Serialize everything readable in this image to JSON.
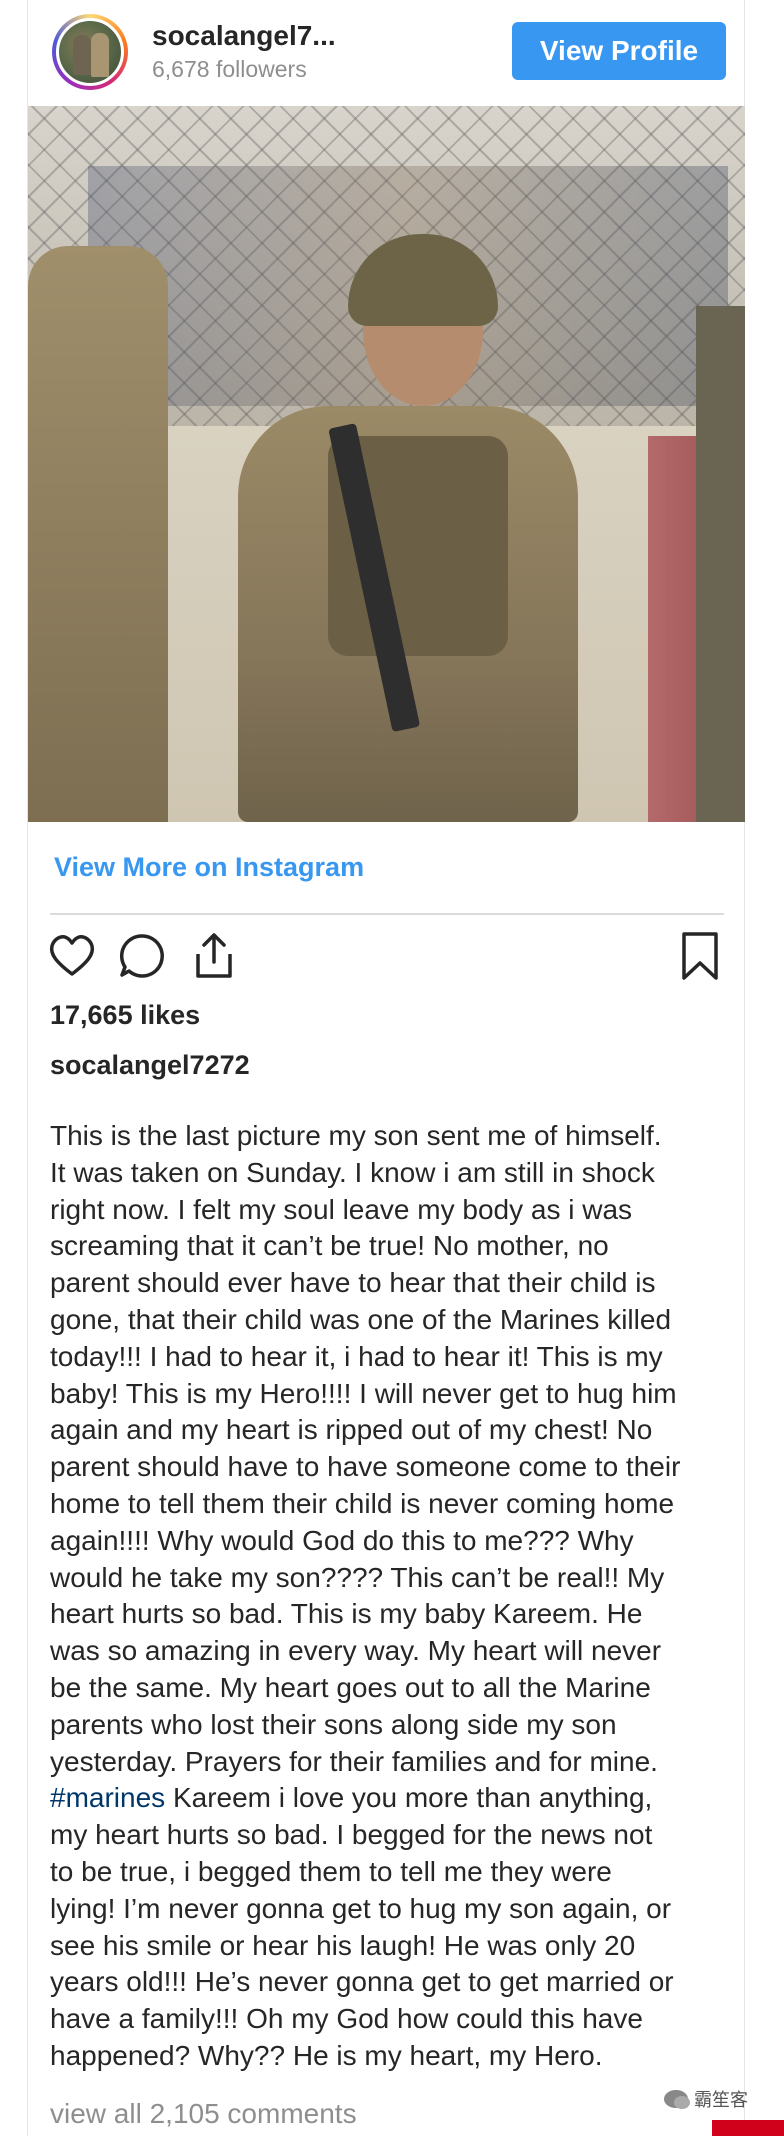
{
  "header": {
    "username": "socalangel7...",
    "followers": "6,678 followers",
    "view_profile_label": "View Profile"
  },
  "post": {
    "view_more_label": "View More on Instagram",
    "likes": "17,665 likes",
    "author": "socalangel7272",
    "caption_part1": "This is the last picture my son sent me of himself.\nIt was taken on Sunday. I know i am still in shock\nright now. I felt my soul leave my body as i was\nscreaming that it can’t be true! No mother, no\nparent should ever have to hear that their child is\ngone, that their child was one of the Marines killed\ntoday!!! I had to hear it, i had to hear it! This is my\nbaby! This is my Hero!!!! I will never get to hug him\nagain and my heart is ripped out of my chest! No\nparent should have to have someone come to their\nhome to tell them their child is never coming home\nagain!!!! Why would God do this to me??? Why\nwould he take my son???? This can’t be real!! My\nheart hurts so bad. This is my baby Kareem. He\nwas so amazing in every way. My heart will never\nbe the same. My heart goes out to all the Marine\nparents who lost their sons along side my son\nyesterday. Prayers for their families and for mine.\n",
    "hashtag": "#marines",
    "caption_part2": " Kareem i love you more than anything,\nmy heart hurts so bad. I begged for the news not\nto be true, i begged them to tell me they were\nlying! I’m never gonna get to hug my son again, or\nsee his smile or hear his laugh! He was only 20\nyears old!!! He’s never gonna get to get married or\nhave a family!!! Oh my God how could this have\nhappened? Why?? He is my heart, my Hero.",
    "view_comments": "view all 2,105 comments"
  },
  "icons": {
    "like": "heart-icon",
    "comment": "comment-icon",
    "share": "share-icon",
    "save": "bookmark-icon"
  },
  "colors": {
    "accent": "#3897f0",
    "text": "#262626",
    "muted": "#8e8e8e",
    "hashtag": "#00376b"
  },
  "watermark": {
    "text": "霸笙客"
  }
}
